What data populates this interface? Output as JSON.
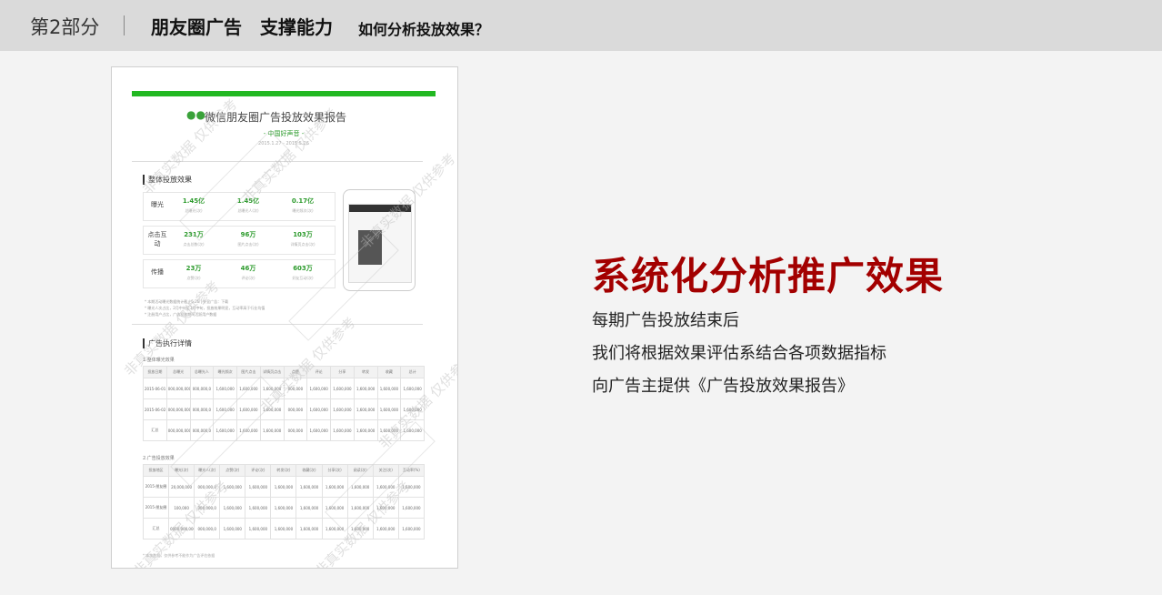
{
  "header": {
    "part": "第2部分",
    "title": "朋友圈广告　支撑能力",
    "subtitle": "如何分析投放效果？"
  },
  "report": {
    "title": "微信朋友圈广告投放效果报告",
    "sub": "- 中国好声音 -",
    "date": "2015.1.27 - 2015.5.26",
    "section1": "整体投放效果",
    "rows": [
      {
        "label": "曝光",
        "metrics": [
          {
            "v": "1.45亿",
            "l": "总曝光(次)"
          },
          {
            "v": "1.45亿",
            "l": "总曝光人(次)"
          },
          {
            "v": "0.17亿",
            "l": "曝光频次(次)"
          }
        ]
      },
      {
        "label": "点击互动",
        "metrics": [
          {
            "v": "231万",
            "l": "点击总数(次)"
          },
          {
            "v": "96万",
            "l": "图片点击(次)"
          },
          {
            "v": "103万",
            "l": "详情页点击(次)"
          }
        ]
      },
      {
        "label": "传播",
        "metrics": [
          {
            "v": "23万",
            "l": "点赞(次)"
          },
          {
            "v": "46万",
            "l": "评论(次)"
          },
          {
            "v": "603万",
            "l": "好友互动(次)"
          }
        ]
      }
    ],
    "notes": [
      "* 本期活动曝光数据统计截止5.26 | 外显广告：下载",
      "* 曝光人次占比，2月中旬至3月中旬，投放效果明显，互动率高于行业均值",
      "* 注册用户占比，广告投放期间活跃用户数据"
    ],
    "section2": "广告执行详情",
    "sub1": "1.整体曝光效果",
    "sub2": "2.广告投放效果",
    "t1_head": [
      "投放日期",
      "总曝光",
      "总曝光人",
      "曝光频次",
      "图片点击",
      "详情页点击",
      "点赞",
      "评论",
      "分享",
      "转发",
      "收藏",
      "总计"
    ],
    "t1_rows": [
      [
        "2015-06-01",
        "000,000,000",
        "000,000,0",
        "1,600,000",
        "1,600,000",
        "1,600,000",
        "000,000",
        "1,600,000",
        "1,600,000",
        "1,600,000",
        "1,600,000",
        "1,600,000"
      ],
      [
        "2015-06-02",
        "000,000,000",
        "000,000,0",
        "1,600,000",
        "1,600,000",
        "1,600,000",
        "000,000",
        "1,600,000",
        "1,600,000",
        "1,600,000",
        "1,600,000",
        "1,600,000"
      ],
      [
        "汇总",
        "000,000,000",
        "000,000,0",
        "1,600,000",
        "1,600,000",
        "1,600,000",
        "000,000",
        "1,600,000",
        "1,600,000",
        "1,600,000",
        "1,600,000",
        "1,600,000"
      ]
    ],
    "t2_head": [
      "投放地区",
      "曝光(次)",
      "曝光人(次)",
      "点赞(次)",
      "评论(次)",
      "转发(次)",
      "收藏(次)",
      "分享(次)",
      "阅读(次)",
      "关注(次)",
      "互动率(%)"
    ],
    "t2_rows": [
      [
        "2015-朋友圈",
        "20,000,000",
        "000,000,0",
        "1,600,000",
        "1,600,000",
        "1,600,000",
        "1,600,000",
        "1,600,000",
        "1,600,000",
        "1,600,000",
        "1,600,000"
      ],
      [
        "2015-朋友圈",
        "100,000",
        "000,000,0",
        "1,600,000",
        "1,600,000",
        "1,600,000",
        "1,600,000",
        "1,600,000",
        "1,600,000",
        "1,600,000",
        "1,600,000"
      ],
      [
        "汇总",
        "0000,000,000",
        "000,000,0",
        "1,600,000",
        "1,600,000",
        "1,600,000",
        "1,600,000",
        "1,600,000",
        "1,600,000",
        "1,600,000",
        "1,600,000"
      ]
    ],
    "footnote": "* 本次数据，仅供参考不能作为广告评估依据",
    "watermark": "非真实数据 仅供参考"
  },
  "headline": "系统化分析推广效果",
  "lines": [
    "每期广告投放结束后",
    "我们将根据效果评估系结合各项数据指标",
    "向广告主提供《广告投放效果报告》"
  ]
}
